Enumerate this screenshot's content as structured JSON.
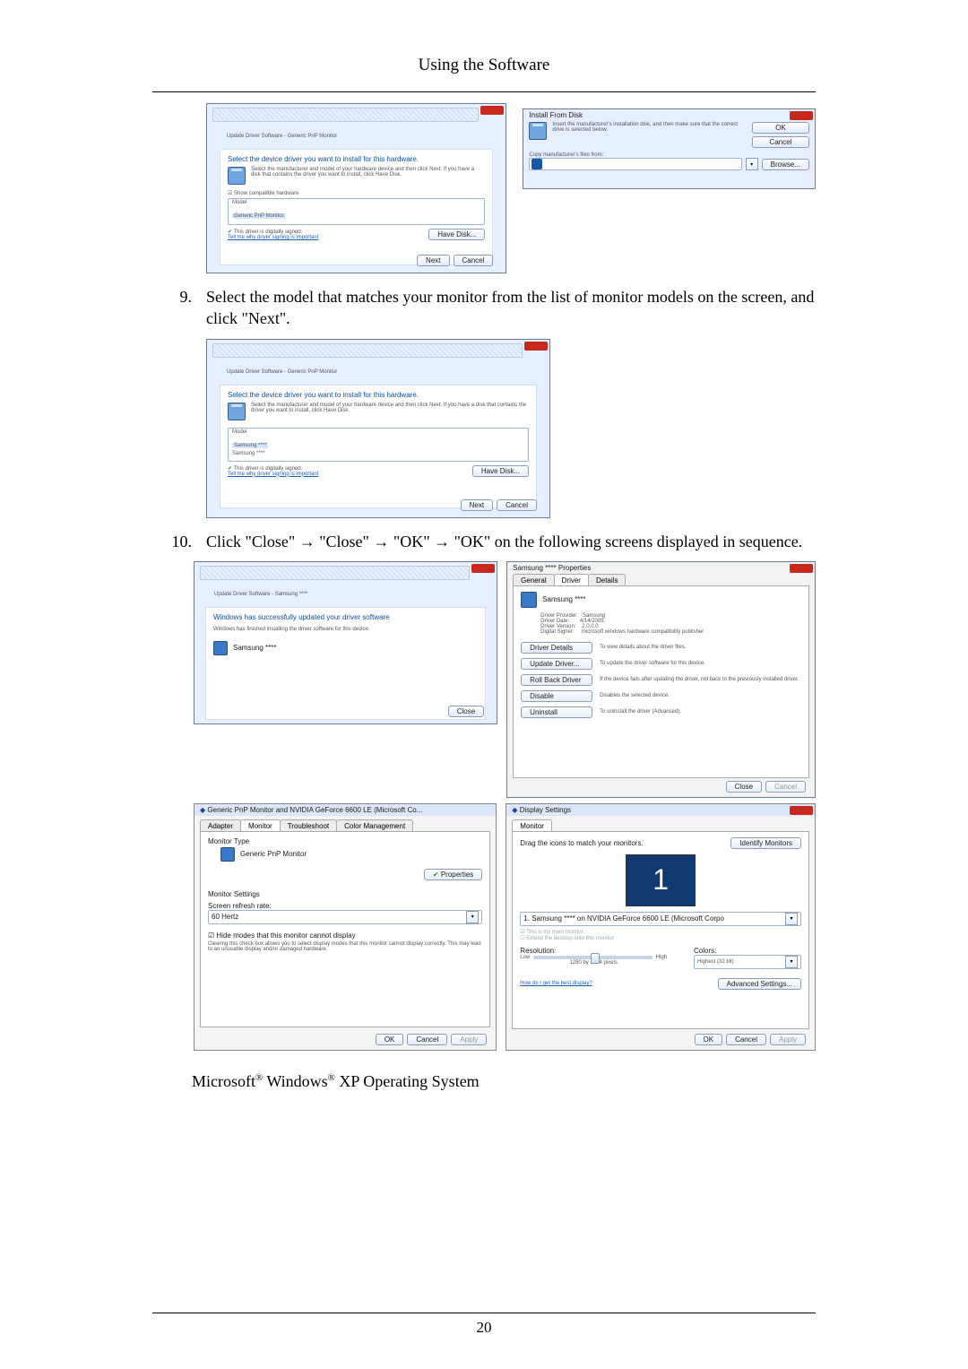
{
  "header": "Using the Software",
  "page_number": "20",
  "wiz1": {
    "crumb": "Update Driver Software - Generic PnP Monitor",
    "headline": "Select the device driver you want to install for this hardware.",
    "desc": "Select the manufacturer and model of your hardware device and then click Next. If you have a disk that contains the driver you want to install, click Have Disk.",
    "show_compatible": "Show compatible hardware",
    "col_model": "Model",
    "model_item": "Generic PnP Monitor",
    "signed": "This driver is digitally signed.",
    "tell_me": "Tell me why driver signing is important",
    "have_disk": "Have Disk...",
    "next": "Next",
    "cancel": "Cancel"
  },
  "filepick": {
    "title": "Install From Disk",
    "msg": "Insert the manufacturer's installation disk, and then make sure that the correct drive is selected below.",
    "ok": "OK",
    "cancel": "Cancel",
    "copy_label": "Copy manufacturer's files from:",
    "browse": "Browse..."
  },
  "step9": {
    "num": "9.",
    "text": "Select the model that matches your monitor from the list of monitor models on the screen, and click \"Next\"."
  },
  "wiz2": {
    "crumb": "Update Driver Software - Generic PnP Monitor",
    "headline": "Select the device driver you want to install for this hardware.",
    "desc": "Select the manufacturer and model of your hardware device and then click Next. If you have a disk that contains the driver you want to install, click Have Disk.",
    "col_model": "Model",
    "m1": "Samsung ****",
    "m2": "Samsung ****",
    "signed": "This driver is digitally signed.",
    "tell_me": "Tell me why driver signing is important",
    "have_disk": "Have Disk...",
    "next": "Next",
    "cancel": "Cancel"
  },
  "step10": {
    "num": "10.",
    "text": "Click \"Close\" → \"Close\" → \"OK\" → \"OK\" on the following screens displayed in sequence."
  },
  "success": {
    "crumb": "Update Driver Software - Samsung ****",
    "headline": "Windows has successfully updated your driver software",
    "sub": "Windows has finished installing the driver software for this device:",
    "device": "Samsung ****",
    "close": "Close"
  },
  "props": {
    "title": "Samsung **** Properties",
    "tab_general": "General",
    "tab_driver": "Driver",
    "tab_details": "Details",
    "name": "Samsung ****",
    "row_provider_l": "Driver Provider:",
    "row_provider_v": "Samsung",
    "row_date_l": "Driver Date:",
    "row_date_v": "4/14/2005",
    "row_ver_l": "Driver Version:",
    "row_ver_v": "2.0.0.0",
    "row_signer_l": "Digital Signer:",
    "row_signer_v": "microsoft windows hardware compatibility publisher",
    "btn_details": "Driver Details",
    "btn_details_d": "To view details about the driver files.",
    "btn_update": "Update Driver...",
    "btn_update_d": "To update the driver software for this device.",
    "btn_rollback": "Roll Back Driver",
    "btn_rollback_d": "If the device fails after updating the driver, roll back to the previously installed driver.",
    "btn_disable": "Disable",
    "btn_disable_d": "Disables the selected device.",
    "btn_uninstall": "Uninstall",
    "btn_uninstall_d": "To uninstall the driver (Advanced).",
    "close": "Close",
    "cancel": "Cancel"
  },
  "monprop": {
    "title": "Generic PnP Monitor and NVIDIA GeForce 6600 LE (Microsoft Co...",
    "tab_adapter": "Adapter",
    "tab_monitor": "Monitor",
    "tab_troubleshoot": "Troubleshoot",
    "tab_color": "Color Management",
    "sect_type": "Monitor Type",
    "type_value": "Generic PnP Monitor",
    "properties": "Properties",
    "sect_settings": "Monitor Settings",
    "refresh_l": "Screen refresh rate:",
    "refresh_v": "60 Hertz",
    "hide_cb": "Hide modes that this monitor cannot display",
    "hide_desc": "Clearing this check box allows you to select display modes that this monitor cannot display correctly. This may lead to an unusable display and/or damaged hardware.",
    "ok": "OK",
    "cancel": "Cancel",
    "apply": "Apply"
  },
  "dispset": {
    "title": "Display Settings",
    "tab_monitor": "Monitor",
    "drag": "Drag the icons to match your monitors.",
    "identify": "Identify Monitors",
    "combo": "1. Samsung **** on NVIDIA GeForce 6600 LE (Microsoft Corpo",
    "cb_main": "This is my main monitor",
    "cb_extend": "Extend the desktop onto this monitor",
    "res_l": "Resolution:",
    "colors_l": "Colors:",
    "lo": "Low",
    "hi": "High",
    "res_value": "1280 by 1024 pixels",
    "colors_value": "Highest (32 bit)",
    "best_link": "How do I get the best display?",
    "advanced": "Advanced Settings...",
    "ok": "OK",
    "cancel": "Cancel",
    "apply": "Apply"
  },
  "os_line": "Microsoft® Windows® XP Operating System"
}
